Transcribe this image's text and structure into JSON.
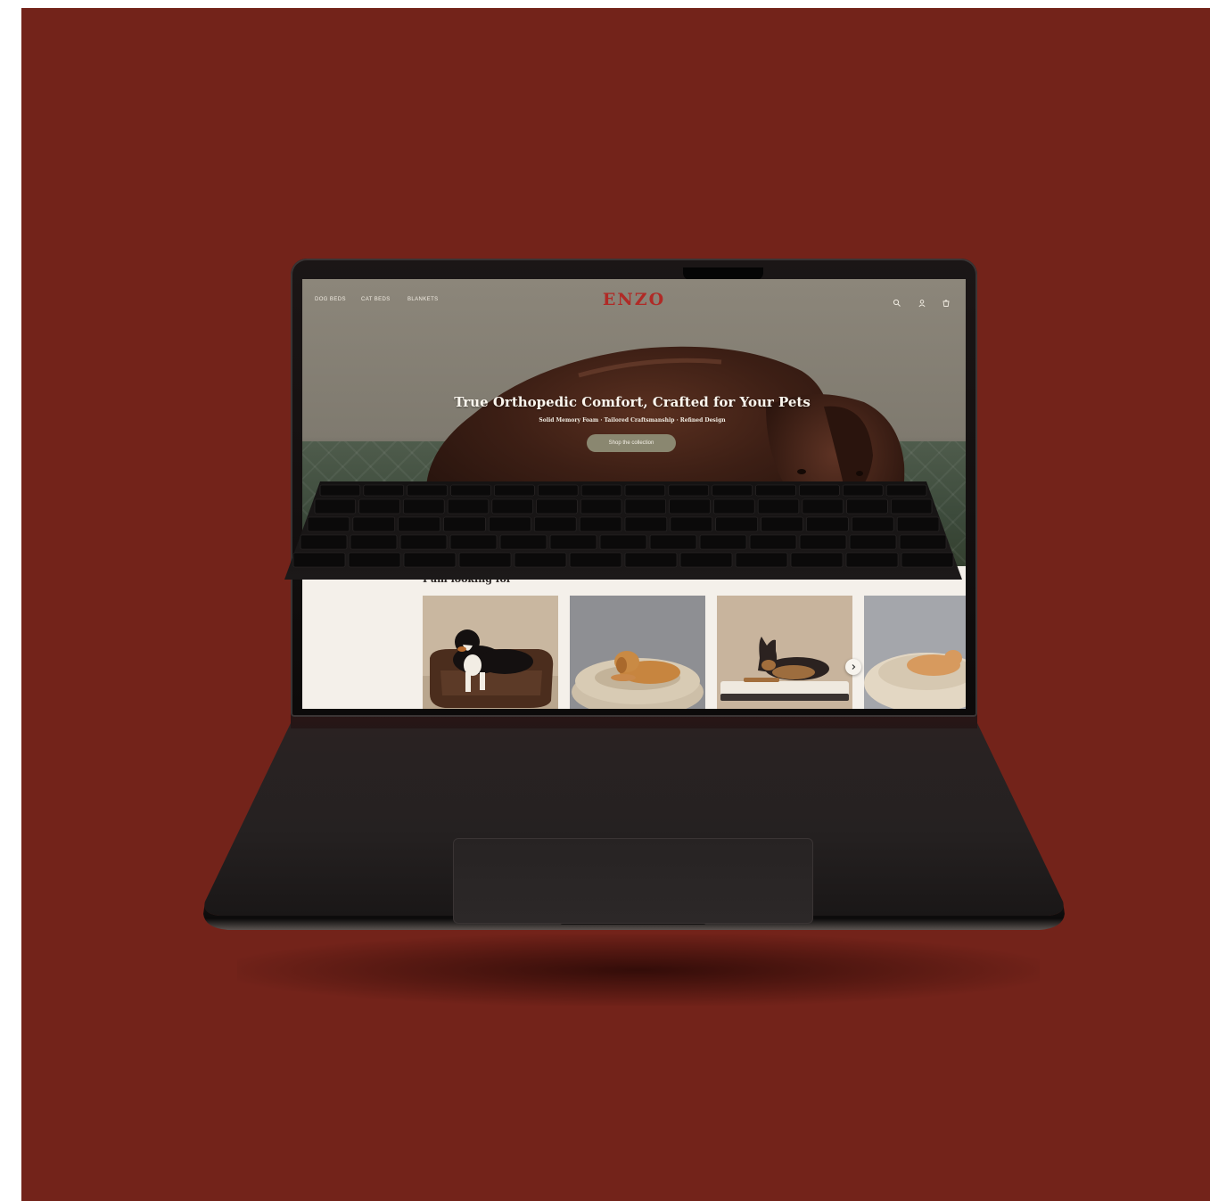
{
  "site": {
    "nav_links": [
      "DOG BEDS",
      "CAT BEDS",
      "BLANKETS"
    ],
    "logo": "ENZO",
    "icons": [
      "search-icon",
      "account-icon",
      "cart-icon"
    ]
  },
  "hero": {
    "title": "True Orthopedic Comfort, Crafted for Your Pets",
    "subtitle": "Solid Memory Foam · Tailored Craftsmanship · Refined Design",
    "button_label": "Shop the collection"
  },
  "section": {
    "title": "I am looking for",
    "cards": [
      "bernese-on-brown-sofa-bed",
      "golden-retriever-on-round-bed",
      "german-shepherd-on-mattress-bed",
      "cat-on-fluffy-donut-bed"
    ],
    "next_icon": "chevron-right-icon"
  },
  "colors": {
    "background": "#73231a",
    "logo": "#b02a26",
    "button": "#8a8770",
    "page_bg": "#f4f0ea",
    "laptop": "#1e1b1b"
  }
}
